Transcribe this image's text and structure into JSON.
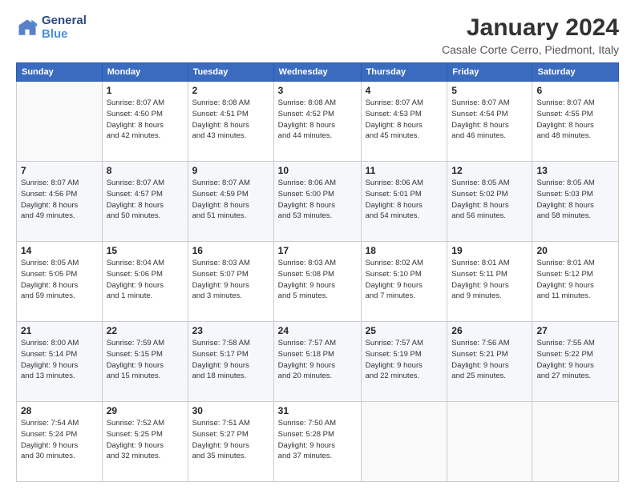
{
  "header": {
    "logo_line1": "General",
    "logo_line2": "Blue",
    "title": "January 2024",
    "subtitle": "Casale Corte Cerro, Piedmont, Italy"
  },
  "weekdays": [
    "Sunday",
    "Monday",
    "Tuesday",
    "Wednesday",
    "Thursday",
    "Friday",
    "Saturday"
  ],
  "weeks": [
    [
      {
        "day": "",
        "info": ""
      },
      {
        "day": "1",
        "info": "Sunrise: 8:07 AM\nSunset: 4:50 PM\nDaylight: 8 hours\nand 42 minutes."
      },
      {
        "day": "2",
        "info": "Sunrise: 8:08 AM\nSunset: 4:51 PM\nDaylight: 8 hours\nand 43 minutes."
      },
      {
        "day": "3",
        "info": "Sunrise: 8:08 AM\nSunset: 4:52 PM\nDaylight: 8 hours\nand 44 minutes."
      },
      {
        "day": "4",
        "info": "Sunrise: 8:07 AM\nSunset: 4:53 PM\nDaylight: 8 hours\nand 45 minutes."
      },
      {
        "day": "5",
        "info": "Sunrise: 8:07 AM\nSunset: 4:54 PM\nDaylight: 8 hours\nand 46 minutes."
      },
      {
        "day": "6",
        "info": "Sunrise: 8:07 AM\nSunset: 4:55 PM\nDaylight: 8 hours\nand 48 minutes."
      }
    ],
    [
      {
        "day": "7",
        "info": "Sunrise: 8:07 AM\nSunset: 4:56 PM\nDaylight: 8 hours\nand 49 minutes."
      },
      {
        "day": "8",
        "info": "Sunrise: 8:07 AM\nSunset: 4:57 PM\nDaylight: 8 hours\nand 50 minutes."
      },
      {
        "day": "9",
        "info": "Sunrise: 8:07 AM\nSunset: 4:59 PM\nDaylight: 8 hours\nand 51 minutes."
      },
      {
        "day": "10",
        "info": "Sunrise: 8:06 AM\nSunset: 5:00 PM\nDaylight: 8 hours\nand 53 minutes."
      },
      {
        "day": "11",
        "info": "Sunrise: 8:06 AM\nSunset: 5:01 PM\nDaylight: 8 hours\nand 54 minutes."
      },
      {
        "day": "12",
        "info": "Sunrise: 8:05 AM\nSunset: 5:02 PM\nDaylight: 8 hours\nand 56 minutes."
      },
      {
        "day": "13",
        "info": "Sunrise: 8:05 AM\nSunset: 5:03 PM\nDaylight: 8 hours\nand 58 minutes."
      }
    ],
    [
      {
        "day": "14",
        "info": "Sunrise: 8:05 AM\nSunset: 5:05 PM\nDaylight: 8 hours\nand 59 minutes."
      },
      {
        "day": "15",
        "info": "Sunrise: 8:04 AM\nSunset: 5:06 PM\nDaylight: 9 hours\nand 1 minute."
      },
      {
        "day": "16",
        "info": "Sunrise: 8:03 AM\nSunset: 5:07 PM\nDaylight: 9 hours\nand 3 minutes."
      },
      {
        "day": "17",
        "info": "Sunrise: 8:03 AM\nSunset: 5:08 PM\nDaylight: 9 hours\nand 5 minutes."
      },
      {
        "day": "18",
        "info": "Sunrise: 8:02 AM\nSunset: 5:10 PM\nDaylight: 9 hours\nand 7 minutes."
      },
      {
        "day": "19",
        "info": "Sunrise: 8:01 AM\nSunset: 5:11 PM\nDaylight: 9 hours\nand 9 minutes."
      },
      {
        "day": "20",
        "info": "Sunrise: 8:01 AM\nSunset: 5:12 PM\nDaylight: 9 hours\nand 11 minutes."
      }
    ],
    [
      {
        "day": "21",
        "info": "Sunrise: 8:00 AM\nSunset: 5:14 PM\nDaylight: 9 hours\nand 13 minutes."
      },
      {
        "day": "22",
        "info": "Sunrise: 7:59 AM\nSunset: 5:15 PM\nDaylight: 9 hours\nand 15 minutes."
      },
      {
        "day": "23",
        "info": "Sunrise: 7:58 AM\nSunset: 5:17 PM\nDaylight: 9 hours\nand 18 minutes."
      },
      {
        "day": "24",
        "info": "Sunrise: 7:57 AM\nSunset: 5:18 PM\nDaylight: 9 hours\nand 20 minutes."
      },
      {
        "day": "25",
        "info": "Sunrise: 7:57 AM\nSunset: 5:19 PM\nDaylight: 9 hours\nand 22 minutes."
      },
      {
        "day": "26",
        "info": "Sunrise: 7:56 AM\nSunset: 5:21 PM\nDaylight: 9 hours\nand 25 minutes."
      },
      {
        "day": "27",
        "info": "Sunrise: 7:55 AM\nSunset: 5:22 PM\nDaylight: 9 hours\nand 27 minutes."
      }
    ],
    [
      {
        "day": "28",
        "info": "Sunrise: 7:54 AM\nSunset: 5:24 PM\nDaylight: 9 hours\nand 30 minutes."
      },
      {
        "day": "29",
        "info": "Sunrise: 7:52 AM\nSunset: 5:25 PM\nDaylight: 9 hours\nand 32 minutes."
      },
      {
        "day": "30",
        "info": "Sunrise: 7:51 AM\nSunset: 5:27 PM\nDaylight: 9 hours\nand 35 minutes."
      },
      {
        "day": "31",
        "info": "Sunrise: 7:50 AM\nSunset: 5:28 PM\nDaylight: 9 hours\nand 37 minutes."
      },
      {
        "day": "",
        "info": ""
      },
      {
        "day": "",
        "info": ""
      },
      {
        "day": "",
        "info": ""
      }
    ]
  ]
}
